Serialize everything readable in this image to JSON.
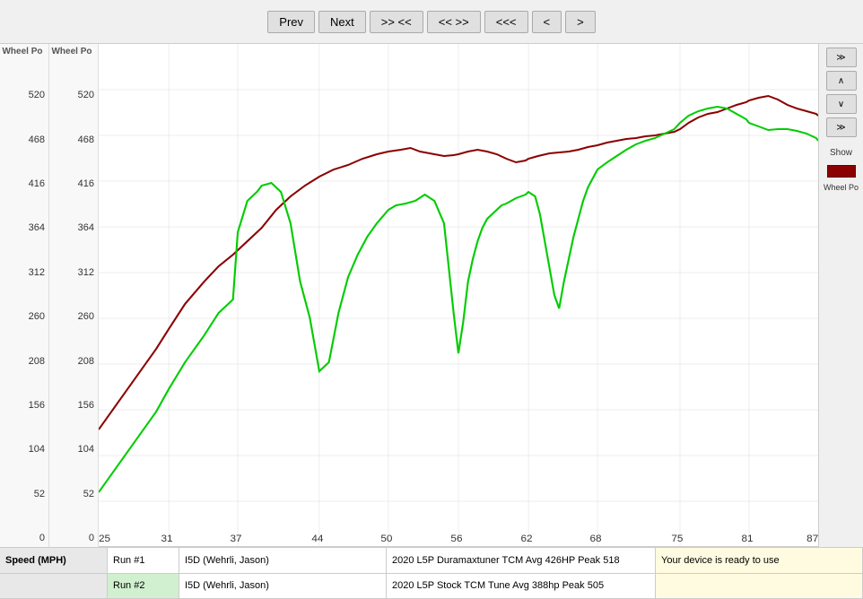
{
  "toolbar": {
    "prev_label": "Prev",
    "next_label": "Next",
    "skip_right_label": ">> <<",
    "skip_left_label": "<< >>",
    "far_left_label": "<<<",
    "arrow_left_label": "<",
    "arrow_right_label": ">"
  },
  "y_axis_left": {
    "title": "Wheel Po",
    "values": [
      "520",
      "468",
      "416",
      "364",
      "312",
      "260",
      "208",
      "156",
      "104",
      "52",
      "0"
    ]
  },
  "y_axis_right": {
    "title": "Wheel Po",
    "values": [
      "520",
      "468",
      "416",
      "364",
      "312",
      "260",
      "208",
      "156",
      "104",
      "52",
      "0"
    ]
  },
  "x_axis": {
    "values": [
      "25",
      "31",
      "37",
      "44",
      "50",
      "56",
      "62",
      "68",
      "75",
      "81",
      "87"
    ]
  },
  "right_panel": {
    "double_down": ">>",
    "single_up": "^",
    "single_down": "v",
    "double_down2": ">>",
    "show_label": "Show",
    "wheel_po_label": "Wheel Po"
  },
  "bottom": {
    "row1": {
      "speed_label": "Speed (MPH)",
      "run_label": "Run #1",
      "run_id": "I5D (Wehrli, Jason)",
      "tune_desc": "2020 L5P Duramaxtuner TCM Avg 426HP Peak 518",
      "device_msg": "Your device is ready to use"
    },
    "row2": {
      "run_label": "Run #2",
      "run_id": "I5D (Wehrli, Jason)",
      "tune_desc": "2020 L5P Stock TCM Tune Avg 388hp Peak 505"
    }
  },
  "chart": {
    "red_curve_color": "#8B0000",
    "green_curve_color": "#00CC00"
  }
}
